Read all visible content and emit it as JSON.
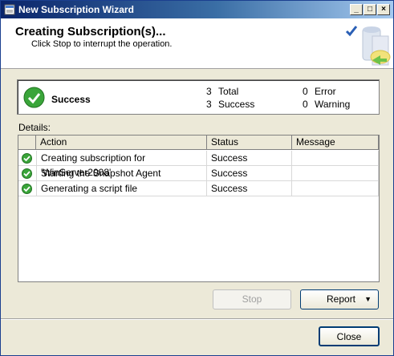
{
  "window": {
    "title": "New Subscription Wizard"
  },
  "header": {
    "title": "Creating Subscription(s)...",
    "subtitle": "Click Stop to interrupt the operation."
  },
  "summary": {
    "status_label": "Success",
    "total_count": "3",
    "total_label": "Total",
    "success_count": "3",
    "success_label": "Success",
    "error_count": "0",
    "error_label": "Error",
    "warning_count": "0",
    "warning_label": "Warning"
  },
  "details": {
    "label": "Details:",
    "columns": [
      "Action",
      "Status",
      "Message"
    ],
    "rows": [
      {
        "action": "Creating subscription for 'WinServer2008'",
        "status": "Success",
        "message": ""
      },
      {
        "action": "Starting the Snapshot Agent",
        "status": "Success",
        "message": ""
      },
      {
        "action": "Generating a script file",
        "status": "Success",
        "message": ""
      }
    ]
  },
  "buttons": {
    "stop": "Stop",
    "report": "Report",
    "close": "Close"
  },
  "colors": {
    "titlebar": "#0a246a",
    "success_green": "#3aa53a"
  }
}
